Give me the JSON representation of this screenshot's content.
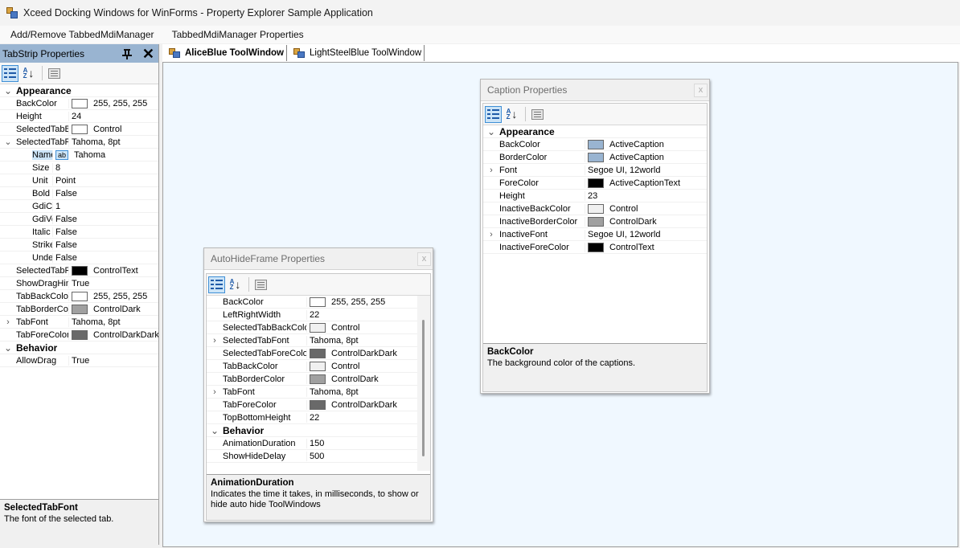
{
  "window": {
    "title": "Xceed Docking Windows for WinForms - Property Explorer Sample Application"
  },
  "menu": {
    "items": [
      "Add/Remove TabbedMdiManager",
      "TabbedMdiManager Properties"
    ]
  },
  "left_panel": {
    "title": "TabStrip Properties",
    "rows": [
      {
        "type": "category",
        "expander": "⌄",
        "name": "Appearance"
      },
      {
        "name": "BackColor",
        "swatch": "#ffffff",
        "value": "255, 255, 255"
      },
      {
        "name": "Height",
        "value": "24"
      },
      {
        "name": "SelectedTabBackColor",
        "swatch": "#ffffff",
        "value": "Control"
      },
      {
        "expander": "⌄",
        "name": "SelectedTabFont",
        "value": "Tahoma, 8pt"
      },
      {
        "indent": true,
        "selected": true,
        "name": "Name",
        "ab": "ab",
        "value": "Tahoma"
      },
      {
        "indent": true,
        "name": "Size",
        "value": "8"
      },
      {
        "indent": true,
        "name": "Unit",
        "value": "Point"
      },
      {
        "indent": true,
        "name": "Bold",
        "value": "False"
      },
      {
        "indent": true,
        "name": "GdiCharSet",
        "value": "1"
      },
      {
        "indent": true,
        "name": "GdiVerticalFont",
        "value": "False"
      },
      {
        "indent": true,
        "name": "Italic",
        "value": "False"
      },
      {
        "indent": true,
        "name": "Strikeout",
        "value": "False"
      },
      {
        "indent": true,
        "name": "Underline",
        "value": "False"
      },
      {
        "name": "SelectedTabForeColor",
        "swatch": "#000000",
        "value": "ControlText"
      },
      {
        "name": "ShowDragHint",
        "value": "True"
      },
      {
        "name": "TabBackColor",
        "swatch": "#ffffff",
        "value": "255, 255, 255"
      },
      {
        "name": "TabBorderColor",
        "swatch": "#a0a0a0",
        "value": "ControlDark"
      },
      {
        "expander": "›",
        "name": "TabFont",
        "value": "Tahoma, 8pt"
      },
      {
        "name": "TabForeColor",
        "swatch": "#696969",
        "value": "ControlDarkDark"
      },
      {
        "type": "category",
        "expander": "⌄",
        "name": "Behavior"
      },
      {
        "name": "AllowDrag",
        "value": "True"
      }
    ],
    "desc_title": "SelectedTabFont",
    "desc_text": "The font of the selected tab."
  },
  "tabs": [
    {
      "label": "AliceBlue ToolWindow",
      "active": true
    },
    {
      "label": "LightSteelBlue ToolWindow",
      "active": false
    }
  ],
  "caption_panel": {
    "title": "Caption Properties",
    "close": "x",
    "rows": [
      {
        "type": "category",
        "expander": "⌄",
        "name": "Appearance"
      },
      {
        "name": "BackColor",
        "swatch": "#99b4d1",
        "value": "ActiveCaption"
      },
      {
        "name": "BorderColor",
        "swatch": "#99b4d1",
        "value": "ActiveCaption"
      },
      {
        "expander": "›",
        "name": "Font",
        "value": "Segoe UI, 12world"
      },
      {
        "name": "ForeColor",
        "swatch": "#000000",
        "value": "ActiveCaptionText"
      },
      {
        "name": "Height",
        "value": "23"
      },
      {
        "name": "InactiveBackColor",
        "swatch": "#f0f0f0",
        "value": "Control"
      },
      {
        "name": "InactiveBorderColor",
        "swatch": "#a0a0a0",
        "value": "ControlDark"
      },
      {
        "expander": "›",
        "name": "InactiveFont",
        "value": "Segoe UI, 12world"
      },
      {
        "name": "InactiveForeColor",
        "swatch": "#000000",
        "value": "ControlText"
      }
    ],
    "desc_title": "BackColor",
    "desc_text": "The background color of the captions."
  },
  "autohide_panel": {
    "title": "AutoHideFrame Properties",
    "close": "x",
    "rows": [
      {
        "name": "BackColor",
        "swatch": "#ffffff",
        "value": "255, 255, 255"
      },
      {
        "name": "LeftRightWidth",
        "value": "22"
      },
      {
        "name": "SelectedTabBackColor",
        "swatch": "#f0f0f0",
        "value": "Control"
      },
      {
        "expander": "›",
        "name": "SelectedTabFont",
        "value": "Tahoma, 8pt"
      },
      {
        "name": "SelectedTabForeColor",
        "swatch": "#696969",
        "value": "ControlDarkDark"
      },
      {
        "name": "TabBackColor",
        "swatch": "#f0f0f0",
        "value": "Control"
      },
      {
        "name": "TabBorderColor",
        "swatch": "#a0a0a0",
        "value": "ControlDark"
      },
      {
        "expander": "›",
        "name": "TabFont",
        "value": "Tahoma, 8pt"
      },
      {
        "name": "TabForeColor",
        "swatch": "#696969",
        "value": "ControlDarkDark"
      },
      {
        "name": "TopBottomHeight",
        "value": "22"
      },
      {
        "type": "category",
        "expander": "⌄",
        "name": "Behavior"
      },
      {
        "name": "AnimationDuration",
        "value": "150"
      },
      {
        "name": "ShowHideDelay",
        "value": "500"
      }
    ],
    "desc_title": "AnimationDuration",
    "desc_text": "Indicates the time it takes, in milliseconds, to show or hide auto hide ToolWindows"
  },
  "toolbar": {
    "sort_alpha_label": "A\nZ",
    "sort_arrow": "↓"
  },
  "colors": {
    "accent": "#99b4d1",
    "mdi_background": "#f0f8ff",
    "selection": "#cce4f7"
  }
}
